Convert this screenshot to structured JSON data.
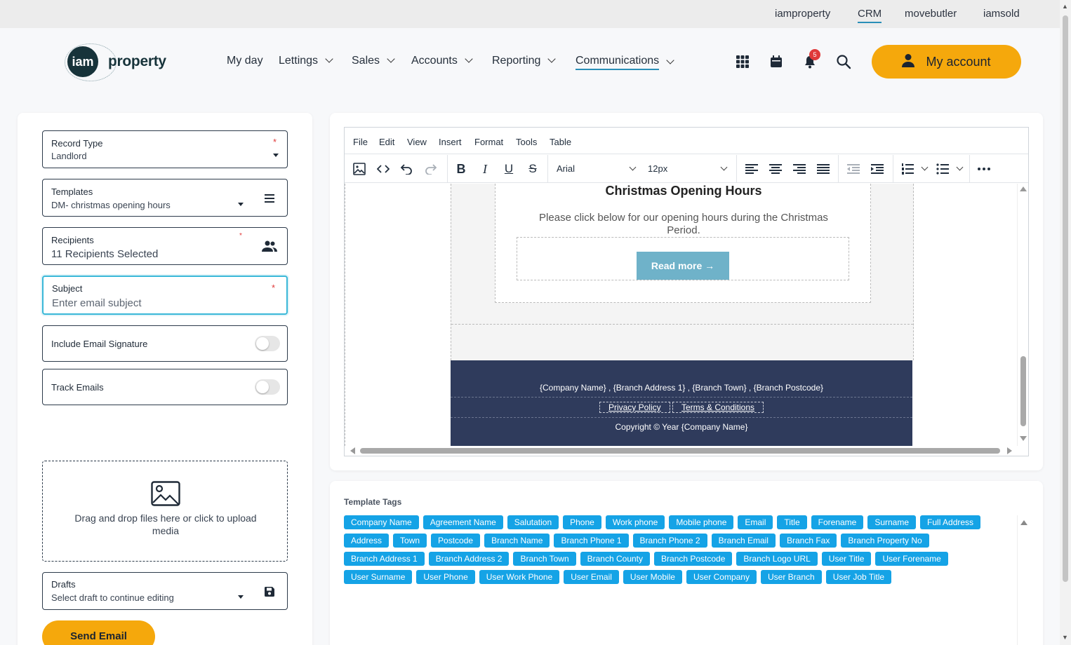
{
  "top_links": [
    "iamproperty",
    "CRM",
    "movebutler",
    "iamsold"
  ],
  "top_active": "CRM",
  "logo": {
    "circle": "iam",
    "text": "property"
  },
  "nav": [
    {
      "label": "My day",
      "dropdown": false
    },
    {
      "label": "Lettings",
      "dropdown": true
    },
    {
      "label": "Sales",
      "dropdown": true
    },
    {
      "label": "Accounts",
      "dropdown": true
    },
    {
      "label": "Reporting",
      "dropdown": true
    },
    {
      "label": "Communications",
      "dropdown": true,
      "active": true
    }
  ],
  "header_icons": [
    "apps-grid-icon",
    "calendar-icon",
    "bell-icon",
    "search-icon"
  ],
  "notification_count": "5",
  "my_account_label": "My account",
  "form": {
    "record_type": {
      "label": "Record Type",
      "value": "Landlord",
      "required": "*"
    },
    "templates": {
      "label": "Templates",
      "value": "DM- christmas opening hours"
    },
    "recipients": {
      "label": "Recipients",
      "value": "11 Recipients Selected",
      "required": "*"
    },
    "subject": {
      "label": "Subject",
      "placeholder": "Enter email subject",
      "required": "*"
    },
    "include_signature": {
      "label": "Include Email Signature"
    },
    "track_emails": {
      "label": "Track Emails"
    },
    "dropzone_text": "Drag and drop files here or click to upload media",
    "drafts": {
      "label": "Drafts",
      "value": "Select draft to continue editing"
    },
    "send_label": "Send Email"
  },
  "editor": {
    "menu": [
      "File",
      "Edit",
      "View",
      "Insert",
      "Format",
      "Tools",
      "Table"
    ],
    "font_family": "Arial",
    "font_size": "12px"
  },
  "email": {
    "title": "Christmas Opening Hours",
    "body": "Please click below for our opening hours during the Christmas Period.",
    "button": "Read more →",
    "footer_address": "{Company Name} , {Branch Address 1} , {Branch Town} , {Branch Postcode}",
    "privacy": "Privacy Policy",
    "terms": "Terms & Conditions",
    "copyright": "Copyright © Year {Company Name}"
  },
  "tags_title": "Template Tags",
  "tags": [
    "Company Name",
    "Agreement Name",
    "Salutation",
    "Phone",
    "Work phone",
    "Mobile phone",
    "Email",
    "Title",
    "Forename",
    "Surname",
    "Full Address",
    "Address",
    "Town",
    "Postcode",
    "Branch Name",
    "Branch Phone 1",
    "Branch Phone 2",
    "Branch Email",
    "Branch Fax",
    "Branch Property No",
    "Branch Address 1",
    "Branch Address 2",
    "Branch Town",
    "Branch County",
    "Branch Postcode",
    "Branch Logo URL",
    "User Title",
    "User Forename",
    "User Surname",
    "User Phone",
    "User Work Phone",
    "User Email",
    "User Mobile",
    "User Company",
    "User Branch",
    "User Job Title"
  ],
  "colors": {
    "accent": "#f5a80c",
    "tag": "#15a3e6",
    "footer": "#2f3b5c",
    "focus": "#3ab8d8"
  }
}
